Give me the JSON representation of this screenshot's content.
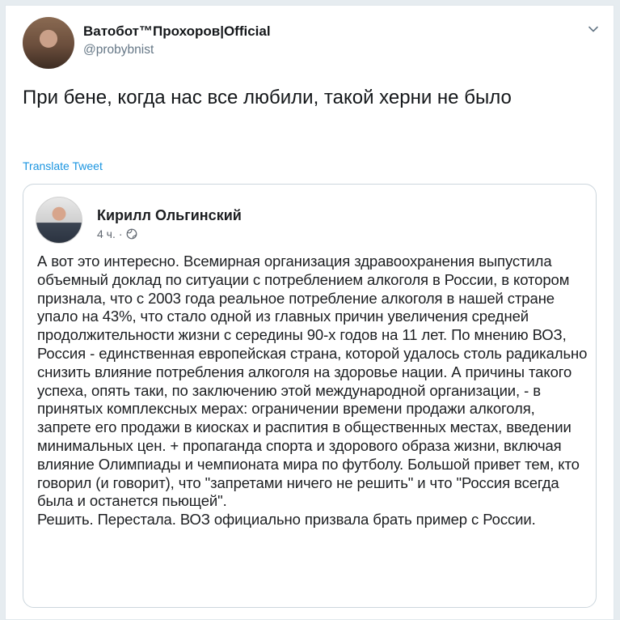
{
  "tweet": {
    "author_name": "Ватобот™Прохоров|Official",
    "author_handle": "@probybnist",
    "text": "При бене, когда нас все любили, такой херни не было",
    "translate_label": "Translate Tweet"
  },
  "embedded_post": {
    "author_name": "Кирилл Ольгинский",
    "time": "4 ч.",
    "separator": "·",
    "body_main": "А вот это интересно. Всемирная организация здравоохранения выпустила объемный доклад по ситуации с потреблением алкоголя в России, в котором признала, что с 2003 года реальное потребление алкоголя в нашей стране упало на 43%, что стало одной из главных причин увеличения средней продолжительности жизни с середины 90-х годов на 11 лет. По мнению ВОЗ, Россия - единственная европейская страна, которой удалось столь радикально снизить влияние потребления алкоголя на здоровье нации. А причины такого успеха, опять таки, по заключению этой международной организации, - в принятых комплексных мерах: ограничении времени продажи алкоголя, запрете его продажи в киосках и распития в общественных местах, введении минимальных цен. + пропаганда спорта и здорового образа жизни, включая влияние Олимпиады и чемпионата мира по футболу. Большой привет тем, кто говорил (и говорит), что \"запретами ничего не решить\" и что \"Россия всегда была и останется пьющей\".",
    "body_tail": "Решить. Перестала. ВОЗ официально призвала брать пример с России."
  }
}
